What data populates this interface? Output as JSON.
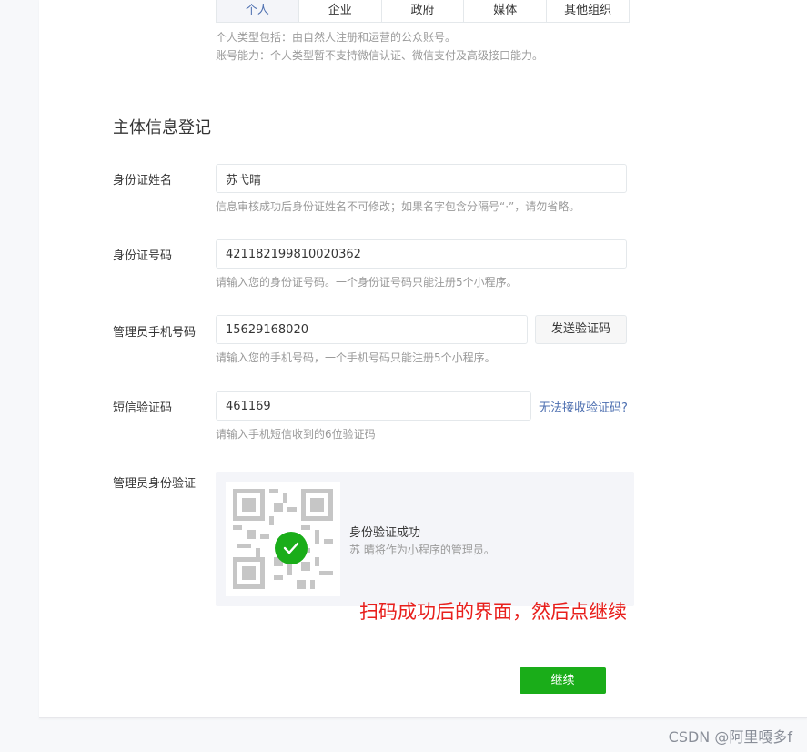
{
  "subject_types": {
    "tabs": [
      "个人",
      "企业",
      "政府",
      "媒体",
      "其他组织"
    ],
    "active": "个人",
    "tip_1": "个人类型包括：由自然人注册和运营的公众账号。",
    "tip_2": "账号能力：个人类型暂不支持微信认证、微信支付及高级接口能力。"
  },
  "section_title": "主体信息登记",
  "form": {
    "id_name": {
      "label": "身份证姓名",
      "value": "苏弋晴",
      "tip": "信息审核成功后身份证姓名不可修改；如果名字包含分隔号“·”，请勿省略。"
    },
    "id_number": {
      "label": "身份证号码",
      "value": "421182199810020362",
      "tip": "请输入您的身份证号码。一个身份证号码只能注册5个小程序。"
    },
    "phone": {
      "label": "管理员手机号码",
      "value": "15629168020",
      "send_code_button": "发送验证码",
      "tip": "请输入您的手机号码，一个手机号码只能注册5个小程序。"
    },
    "sms_code": {
      "label": "短信验证码",
      "value": "461169",
      "help_link": "无法接收验证码?",
      "tip": "请输入手机短信收到的6位验证码"
    },
    "admin_verify": {
      "label": "管理员身份验证",
      "status_title": "身份验证成功",
      "status_desc": "苏 晴将作为小程序的管理员。"
    }
  },
  "annotation": "扫码成功后的界面，然后点继续",
  "continue_button": "继续",
  "watermark": "CSDN @阿里嘎多f",
  "colors": {
    "primary": "#1aad19",
    "link": "#4d6fb0",
    "annotation": "#e8201d"
  }
}
